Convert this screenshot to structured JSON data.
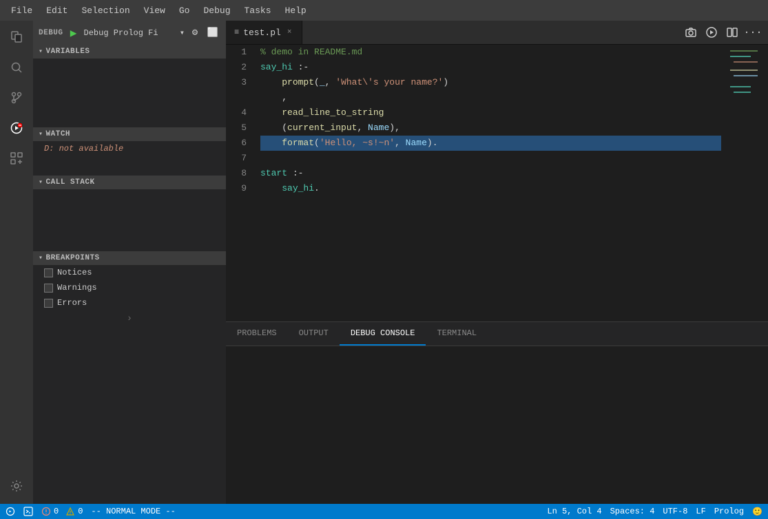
{
  "menubar": {
    "items": [
      "File",
      "Edit",
      "Selection",
      "View",
      "Go",
      "Debug",
      "Tasks",
      "Help"
    ]
  },
  "activity": {
    "icons": [
      {
        "name": "files-icon",
        "symbol": "⎘"
      },
      {
        "name": "search-icon",
        "symbol": "🔍"
      },
      {
        "name": "source-control-icon",
        "symbol": "⑂"
      },
      {
        "name": "debug-icon",
        "symbol": "🚫"
      },
      {
        "name": "extensions-icon",
        "symbol": "⊞"
      }
    ],
    "bottom": [
      {
        "name": "settings-icon",
        "symbol": "⚙"
      }
    ]
  },
  "debug": {
    "label": "DEBUG",
    "config_name": "Debug Prolog Fi",
    "sections": {
      "variables": {
        "label": "VARIABLES"
      },
      "watch": {
        "label": "WATCH",
        "items": [
          {
            "text": "D: not available"
          }
        ]
      },
      "call_stack": {
        "label": "CALL STACK"
      },
      "breakpoints": {
        "label": "BREAKPOINTS",
        "items": [
          {
            "label": "Notices"
          },
          {
            "label": "Warnings"
          },
          {
            "label": "Errors"
          }
        ]
      }
    }
  },
  "editor": {
    "tab": {
      "icon": "≡",
      "filename": "test.pl",
      "close": "×"
    },
    "lines": [
      {
        "num": "1",
        "content": "% demo in README.md",
        "type": "comment"
      },
      {
        "num": "2",
        "content": "say_hi :-",
        "type": "code"
      },
      {
        "num": "3",
        "content": "    prompt(_, 'What\\'s your name?')",
        "type": "code"
      },
      {
        "num": "4",
        "content": "    ,",
        "type": "code_cont"
      },
      {
        "num": "5",
        "content": "    read_line_to_string(current_input, Name),",
        "type": "code"
      },
      {
        "num": "6",
        "content": "    format('Hello, ~s!~n', Name).",
        "type": "code",
        "highlighted": true
      },
      {
        "num": "7",
        "content": "",
        "type": "blank"
      },
      {
        "num": "8",
        "content": "start :-",
        "type": "code"
      },
      {
        "num": "9",
        "content": "    say_hi.",
        "type": "code"
      }
    ]
  },
  "bottom_panel": {
    "tabs": [
      "PROBLEMS",
      "OUTPUT",
      "DEBUG CONSOLE",
      "TERMINAL"
    ],
    "active_tab": "DEBUG CONSOLE"
  },
  "status_bar": {
    "errors": "0",
    "warnings": "0",
    "vim_mode": "-- NORMAL MODE --",
    "line": "Ln 5, Col 4",
    "spaces": "Spaces: 4",
    "encoding": "UTF-8",
    "line_ending": "LF",
    "language": "Prolog",
    "smiley": "🙂"
  }
}
